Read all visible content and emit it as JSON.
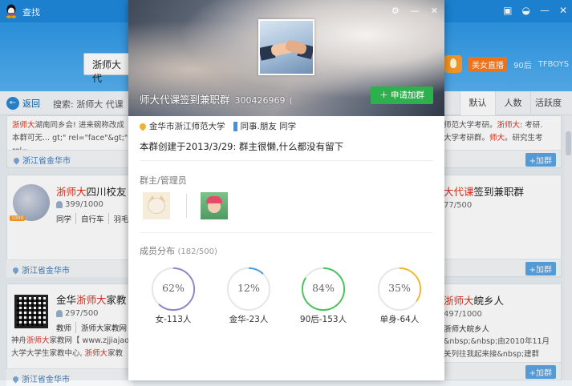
{
  "window": {
    "title": "查找"
  },
  "search": {
    "value": "浙师大 代"
  },
  "header_tags": {
    "live": "美女直播",
    "tag_90": "90后",
    "tag_tfboys": "TFBOYS"
  },
  "filter": {
    "back": "返回",
    "crumb": "搜索: 浙师大 代课",
    "sort_default": "默认",
    "sort_members": "人数",
    "sort_active": "活跃度"
  },
  "cards": {
    "c1": {
      "line1_hl": "浙师大",
      "line1": "湖南同乡会! 进来碗称改成",
      "line2": "本群可无... gt;\" rel=\"face\"&gt;\" rel=",
      "loc": "浙江省金华市",
      "add": "+加群"
    },
    "c2": {
      "title_hl": "浙师大",
      "title": "四川校友",
      "members": "399/1000",
      "chips": [
        "同学",
        "自行车",
        "羽毛球"
      ],
      "badge": "1000",
      "loc": "浙江省金华市",
      "add": "+加群"
    },
    "c3": {
      "title_pre": "金华",
      "title_hl": "浙师大",
      "title": "家教",
      "members": "297/500",
      "chips": [
        "教师",
        "浙师大家教网"
      ],
      "line1": "神舟",
      "line1_hl": "浙师大",
      "line1b": "家教网【 www.zjjiajao.",
      "line2": "大学大学生家教中心, ",
      "line2_hl": "浙师大",
      "line2b": "家教",
      "loc": "浙江省金华市"
    },
    "r1": {
      "line1": "师范大学考研。",
      "line1_hl": "浙师大",
      "line1b": ": 考研.",
      "line2": "大学考研群。",
      "line2_hl": "师大",
      "line2b": "。研究生考",
      "add": "+加群"
    },
    "r2": {
      "title_hl": "大代课",
      "title": "签到兼职群",
      "members": "77/500",
      "add": "+加群"
    },
    "r3": {
      "title_hl": "浙师大",
      "title": "皖乡人",
      "members": "497/1000",
      "chips": [
        "浙师大皖乡人"
      ],
      "line1": "&nbsp;&nbsp;由2010年11月",
      "line2": "关列往我起来接&nbsp;建群",
      "add": "+加群"
    }
  },
  "modal": {
    "group_name": "师大代课签到兼职群",
    "group_id": "300426969",
    "join": "申请加群",
    "location": "金华市浙江师范大学",
    "tags": "同事.朋友   同学",
    "intro": "本群创建于2013/3/29:  群主很懒,什么都没有留下",
    "admins_title": "群主/管理员",
    "members_title": "成员分布",
    "members_count": "(182/500)",
    "stats": [
      {
        "pct": "62%",
        "value": 0.62,
        "caption": "女-113人",
        "color": "#8e86c8"
      },
      {
        "pct": "12%",
        "value": 0.12,
        "caption": "金华-23人",
        "color": "#4b9fdc"
      },
      {
        "pct": "84%",
        "value": 0.84,
        "caption": "90后-153人",
        "color": "#49c25a"
      },
      {
        "pct": "35%",
        "value": 0.35,
        "caption": "单身-64人",
        "color": "#f0b830"
      }
    ]
  }
}
